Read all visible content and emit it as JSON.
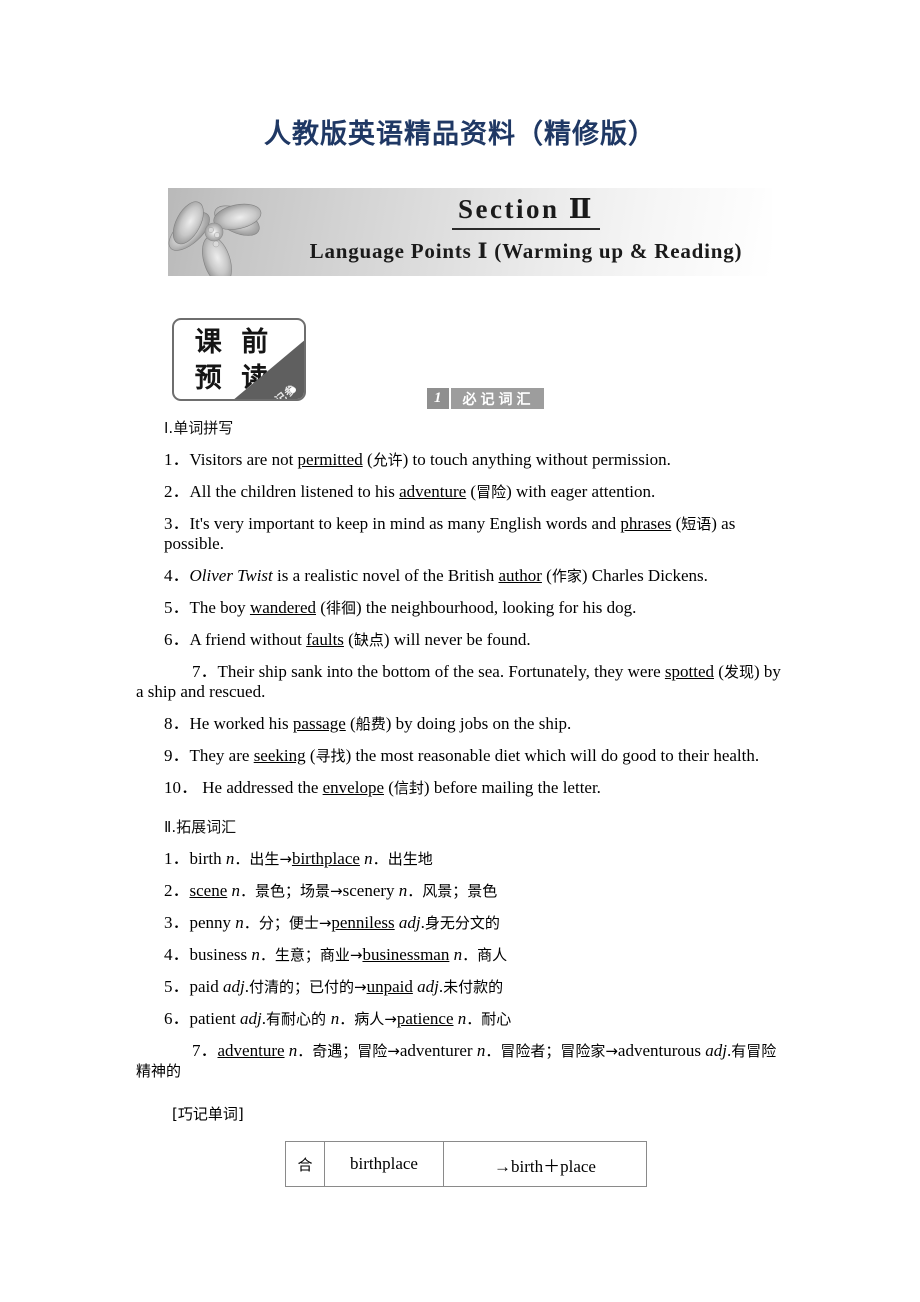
{
  "page_header": "人教版英语精品资料（精修版）",
  "banner": {
    "title": "Section Ⅱ",
    "subtitle": "Language Points Ⅰ (Warming up & Reading)",
    "flower_icon": "flower-photo"
  },
  "pre_read_badge": {
    "line1": "课 前",
    "line2": "预 读",
    "corner_text": "记参"
  },
  "topic_tag": {
    "number": "1",
    "label": "必记词汇"
  },
  "sections": [
    {
      "heading": "Ⅰ.单词拼写",
      "items": [
        {
          "num": "1．",
          "parts": [
            {
              "t": "Visitors are not ",
              "s": "plain"
            },
            {
              "t": "permitted",
              "s": "u"
            },
            {
              "t": " (",
              "s": "plain"
            },
            {
              "t": "允许",
              "s": "cn"
            },
            {
              "t": ") to touch anything without permission.",
              "s": "plain"
            }
          ]
        },
        {
          "num": "2．",
          "parts": [
            {
              "t": "All the children listened to his ",
              "s": "plain"
            },
            {
              "t": "adventure",
              "s": "u"
            },
            {
              "t": " (",
              "s": "plain"
            },
            {
              "t": "冒险",
              "s": "cn"
            },
            {
              "t": ") with eager attention.",
              "s": "plain"
            }
          ]
        },
        {
          "num": "3．",
          "parts": [
            {
              "t": "It's very important to keep in mind as many English words and ",
              "s": "plain"
            },
            {
              "t": "phrases",
              "s": "u"
            },
            {
              "t": " (",
              "s": "plain"
            },
            {
              "t": "短语",
              "s": "cn"
            },
            {
              "t": ") as possible.",
              "s": "plain"
            }
          ]
        },
        {
          "num": "4．",
          "parts": [
            {
              "t": "Oliver Twist",
              "s": "it"
            },
            {
              "t": " is a realistic novel of the British ",
              "s": "plain"
            },
            {
              "t": "author",
              "s": "u"
            },
            {
              "t": " (",
              "s": "plain"
            },
            {
              "t": "作家",
              "s": "cn"
            },
            {
              "t": ") Charles Dickens.",
              "s": "plain"
            }
          ]
        },
        {
          "num": "5．",
          "parts": [
            {
              "t": "The boy ",
              "s": "plain"
            },
            {
              "t": "wandered",
              "s": "u"
            },
            {
              "t": " (",
              "s": "plain"
            },
            {
              "t": "徘徊",
              "s": "cn"
            },
            {
              "t": ") the neighbourhood, looking for his dog.",
              "s": "plain"
            }
          ]
        },
        {
          "num": "6．",
          "parts": [
            {
              "t": "A friend without ",
              "s": "plain"
            },
            {
              "t": "faults",
              "s": "u"
            },
            {
              "t": " (",
              "s": "plain"
            },
            {
              "t": "缺点",
              "s": "cn"
            },
            {
              "t": ") will never be found.",
              "s": "plain"
            }
          ]
        },
        {
          "num": "7．",
          "wrap": true,
          "parts": [
            {
              "t": "Their ship sank into the bottom of the sea. Fortunately, they were ",
              "s": "plain"
            },
            {
              "t": "spotted",
              "s": "u"
            },
            {
              "t": " (",
              "s": "plain"
            },
            {
              "t": "发现",
              "s": "cn"
            },
            {
              "t": ") by a ship and rescued.",
              "s": "plain"
            }
          ]
        },
        {
          "num": "8．",
          "parts": [
            {
              "t": "He worked his ",
              "s": "plain"
            },
            {
              "t": "passage",
              "s": "u"
            },
            {
              "t": " (",
              "s": "plain"
            },
            {
              "t": "船费",
              "s": "cn"
            },
            {
              "t": ") by doing jobs on the ship.",
              "s": "plain"
            }
          ]
        },
        {
          "num": "9．",
          "parts": [
            {
              "t": "They are ",
              "s": "plain"
            },
            {
              "t": "seeking",
              "s": "u"
            },
            {
              "t": " (",
              "s": "plain"
            },
            {
              "t": "寻找",
              "s": "cn"
            },
            {
              "t": ") the most reasonable diet which will do good to their health.",
              "s": "plain"
            }
          ]
        },
        {
          "num": "10．",
          "parts": [
            {
              "t": " He addressed the ",
              "s": "plain"
            },
            {
              "t": "envelope",
              "s": "u"
            },
            {
              "t": " (",
              "s": "plain"
            },
            {
              "t": "信封",
              "s": "cn"
            },
            {
              "t": ") before mailing the letter.",
              "s": "plain"
            }
          ]
        }
      ]
    },
    {
      "heading": "Ⅱ.拓展词汇",
      "items": [
        {
          "num": "1．",
          "parts": [
            {
              "t": "birth ",
              "s": "plain"
            },
            {
              "t": "n",
              "s": "it"
            },
            {
              "t": "．",
              "s": "cn"
            },
            {
              "t": "出生→",
              "s": "cn"
            },
            {
              "t": "birthplace",
              "s": "u"
            },
            {
              "t": " ",
              "s": "plain"
            },
            {
              "t": "n",
              "s": "it"
            },
            {
              "t": "．",
              "s": "cn"
            },
            {
              "t": "出生地",
              "s": "cn"
            }
          ]
        },
        {
          "num": "2．",
          "parts": [
            {
              "t": "scene",
              "s": "u"
            },
            {
              "t": " ",
              "s": "plain"
            },
            {
              "t": "n",
              "s": "it"
            },
            {
              "t": "．",
              "s": "cn"
            },
            {
              "t": "景色；场景→",
              "s": "cn"
            },
            {
              "t": "scenery ",
              "s": "plain"
            },
            {
              "t": "n",
              "s": "it"
            },
            {
              "t": "．",
              "s": "cn"
            },
            {
              "t": "风景；景色",
              "s": "cn"
            }
          ]
        },
        {
          "num": "3．",
          "parts": [
            {
              "t": "penny ",
              "s": "plain"
            },
            {
              "t": "n",
              "s": "it"
            },
            {
              "t": "．",
              "s": "cn"
            },
            {
              "t": "分；便士→",
              "s": "cn"
            },
            {
              "t": "penniless",
              "s": "u"
            },
            {
              "t": " ",
              "s": "plain"
            },
            {
              "t": "adj",
              "s": "it"
            },
            {
              "t": ".",
              "s": "plain"
            },
            {
              "t": "身无分文的",
              "s": "cn"
            }
          ]
        },
        {
          "num": "4．",
          "parts": [
            {
              "t": "business ",
              "s": "plain"
            },
            {
              "t": "n",
              "s": "it"
            },
            {
              "t": "．",
              "s": "cn"
            },
            {
              "t": "生意；商业→",
              "s": "cn"
            },
            {
              "t": "businessman",
              "s": "u"
            },
            {
              "t": " ",
              "s": "plain"
            },
            {
              "t": "n",
              "s": "it"
            },
            {
              "t": "．",
              "s": "cn"
            },
            {
              "t": "商人",
              "s": "cn"
            }
          ]
        },
        {
          "num": "5．",
          "parts": [
            {
              "t": "paid ",
              "s": "plain"
            },
            {
              "t": "adj",
              "s": "it"
            },
            {
              "t": ".",
              "s": "plain"
            },
            {
              "t": "付清的；已付的→",
              "s": "cn"
            },
            {
              "t": "unpaid",
              "s": "u"
            },
            {
              "t": " ",
              "s": "plain"
            },
            {
              "t": "adj",
              "s": "it"
            },
            {
              "t": ".",
              "s": "plain"
            },
            {
              "t": "未付款的",
              "s": "cn"
            }
          ]
        },
        {
          "num": "6．",
          "parts": [
            {
              "t": "patient ",
              "s": "plain"
            },
            {
              "t": "adj",
              "s": "it"
            },
            {
              "t": ".",
              "s": "plain"
            },
            {
              "t": "有耐心的  ",
              "s": "cn"
            },
            {
              "t": "n",
              "s": "it"
            },
            {
              "t": "．",
              "s": "cn"
            },
            {
              "t": "病人→",
              "s": "cn"
            },
            {
              "t": "patience",
              "s": "u"
            },
            {
              "t": " ",
              "s": "plain"
            },
            {
              "t": "n",
              "s": "it"
            },
            {
              "t": "．",
              "s": "cn"
            },
            {
              "t": "耐心",
              "s": "cn"
            }
          ]
        },
        {
          "num": "7．",
          "wrap": true,
          "parts": [
            {
              "t": "adventure",
              "s": "u"
            },
            {
              "t": " ",
              "s": "plain"
            },
            {
              "t": "n",
              "s": "it"
            },
            {
              "t": "．",
              "s": "cn"
            },
            {
              "t": "奇遇；冒险→",
              "s": "cn"
            },
            {
              "t": "adventurer ",
              "s": "plain"
            },
            {
              "t": "n",
              "s": "it"
            },
            {
              "t": "．",
              "s": "cn"
            },
            {
              "t": "冒险者；冒险家→",
              "s": "cn"
            },
            {
              "t": "adventurous ",
              "s": "plain"
            },
            {
              "t": "adj",
              "s": "it"
            },
            {
              "t": ".",
              "s": "plain"
            },
            {
              "t": "有冒险精神的",
              "s": "cn"
            }
          ]
        }
      ]
    }
  ],
  "bracket_note": "[巧记单词]",
  "word_table": {
    "rows": [
      {
        "type": "合",
        "word": "birthplace",
        "formula": "→birth＋place"
      }
    ]
  },
  "colors": {
    "header_blue": "#1f3864",
    "tag_gray": "#9d9d9d",
    "tag_num_gray": "#8f8f8f",
    "badge_corner": "#5f5f5f",
    "table_border": "#8a8a8a"
  }
}
